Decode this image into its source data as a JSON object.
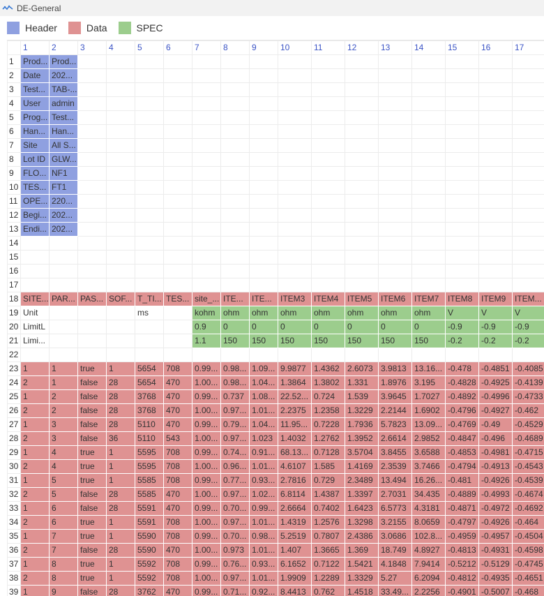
{
  "window": {
    "title": "DE-General"
  },
  "colors": {
    "header": "#8fa0e0",
    "data": "#df9292",
    "spec": "#9ccd8d",
    "column_number": "#3b54c6"
  },
  "legend": [
    {
      "label": "Header",
      "color": "#8fa0e0",
      "icon": "legend-swatch-header"
    },
    {
      "label": "Data",
      "color": "#df9292",
      "icon": "legend-swatch-data"
    },
    {
      "label": "SPEC",
      "color": "#9ccd8d",
      "icon": "legend-swatch-spec"
    }
  ],
  "grid": {
    "column_headers": [
      "1",
      "2",
      "3",
      "4",
      "5",
      "6",
      "7",
      "8",
      "9",
      "10",
      "11",
      "12",
      "13",
      "14",
      "15",
      "16",
      "17"
    ],
    "rows": [
      {
        "num": "1",
        "type": "header",
        "cells": [
          "Prod...",
          "Prod..."
        ]
      },
      {
        "num": "2",
        "type": "header",
        "cells": [
          "Date",
          "202..."
        ]
      },
      {
        "num": "3",
        "type": "header",
        "cells": [
          "Test...",
          "TAB-..."
        ]
      },
      {
        "num": "4",
        "type": "header",
        "cells": [
          "User",
          "admin"
        ]
      },
      {
        "num": "5",
        "type": "header",
        "cells": [
          "Prog...",
          "Test..."
        ]
      },
      {
        "num": "6",
        "type": "header",
        "cells": [
          "Han...",
          "Han..."
        ]
      },
      {
        "num": "7",
        "type": "header",
        "cells": [
          "Site",
          "All S..."
        ]
      },
      {
        "num": "8",
        "type": "header",
        "cells": [
          "Lot ID",
          "GLW..."
        ]
      },
      {
        "num": "9",
        "type": "header",
        "cells": [
          "FLO...",
          "NF1"
        ]
      },
      {
        "num": "10",
        "type": "header",
        "cells": [
          "TES...",
          "FT1"
        ]
      },
      {
        "num": "11",
        "type": "header",
        "cells": [
          "OPE...",
          "220..."
        ]
      },
      {
        "num": "12",
        "type": "header",
        "cells": [
          "Begi...",
          "202..."
        ]
      },
      {
        "num": "13",
        "type": "header",
        "cells": [
          "Endi...",
          "202..."
        ]
      },
      {
        "num": "14",
        "type": "empty",
        "cells": []
      },
      {
        "num": "15",
        "type": "empty",
        "cells": []
      },
      {
        "num": "16",
        "type": "empty",
        "cells": []
      },
      {
        "num": "17",
        "type": "empty",
        "cells": []
      },
      {
        "num": "18",
        "type": "data",
        "cells": [
          "SITE...",
          "PAR...",
          "PAS...",
          "SOF...",
          "T_TI...",
          "TES...",
          "site_...",
          "ITE...",
          "ITE...",
          "ITEM3",
          "ITEM4",
          "ITEM5",
          "ITEM6",
          "ITEM7",
          "ITEM8",
          "ITEM9",
          "ITEM..."
        ]
      },
      {
        "num": "19",
        "type": "spec",
        "cells": [
          "Unit",
          "",
          "",
          "",
          "ms",
          "",
          "kohm",
          "ohm",
          "ohm",
          "ohm",
          "ohm",
          "ohm",
          "ohm",
          "ohm",
          "V",
          "V",
          "V"
        ]
      },
      {
        "num": "20",
        "type": "spec",
        "cells": [
          "LimitL",
          "",
          "",
          "",
          "",
          "",
          "0.9",
          "0",
          "0",
          "0",
          "0",
          "0",
          "0",
          "0",
          "-0.9",
          "-0.9",
          "-0.9"
        ]
      },
      {
        "num": "21",
        "type": "spec",
        "cells": [
          "Limi...",
          "",
          "",
          "",
          "",
          "",
          "1.1",
          "150",
          "150",
          "150",
          "150",
          "150",
          "150",
          "150",
          "-0.2",
          "-0.2",
          "-0.2"
        ]
      },
      {
        "num": "22",
        "type": "empty",
        "cells": []
      },
      {
        "num": "23",
        "type": "data",
        "cells": [
          "1",
          "1",
          "true",
          "1",
          "5654",
          "708",
          "0.99...",
          "0.98...",
          "1.09...",
          "9.9877",
          "1.4362",
          "2.6073",
          "3.9813",
          "13.16...",
          "-0.478",
          "-0.4851",
          "-0.4085"
        ]
      },
      {
        "num": "24",
        "type": "data",
        "cells": [
          "2",
          "1",
          "false",
          "28",
          "5654",
          "470",
          "1.00...",
          "0.98...",
          "1.04...",
          "1.3864",
          "1.3802",
          "1.331",
          "1.8976",
          "3.195",
          "-0.4828",
          "-0.4925",
          "-0.4139"
        ]
      },
      {
        "num": "25",
        "type": "data",
        "cells": [
          "1",
          "2",
          "false",
          "28",
          "3768",
          "470",
          "0.99...",
          "0.737",
          "1.08...",
          "22.52...",
          "0.724",
          "1.539",
          "3.9645",
          "1.7027",
          "-0.4892",
          "-0.4996",
          "-0.4733"
        ]
      },
      {
        "num": "26",
        "type": "data",
        "cells": [
          "2",
          "2",
          "false",
          "28",
          "3768",
          "470",
          "1.00...",
          "0.97...",
          "1.01...",
          "2.2375",
          "1.2358",
          "1.3229",
          "2.2144",
          "1.6902",
          "-0.4796",
          "-0.4927",
          "-0.462"
        ]
      },
      {
        "num": "27",
        "type": "data",
        "cells": [
          "1",
          "3",
          "false",
          "28",
          "5110",
          "470",
          "0.99...",
          "0.79...",
          "1.04...",
          "11.95...",
          "0.7228",
          "1.7936",
          "5.7823",
          "13.09...",
          "-0.4769",
          "-0.49",
          "-0.4529"
        ]
      },
      {
        "num": "28",
        "type": "data",
        "cells": [
          "2",
          "3",
          "false",
          "36",
          "5110",
          "543",
          "1.00...",
          "0.97...",
          "1.023",
          "1.4032",
          "1.2762",
          "1.3952",
          "2.6614",
          "2.9852",
          "-0.4847",
          "-0.496",
          "-0.4689"
        ]
      },
      {
        "num": "29",
        "type": "data",
        "cells": [
          "1",
          "4",
          "true",
          "1",
          "5595",
          "708",
          "0.99...",
          "0.74...",
          "0.91...",
          "68.13...",
          "0.7128",
          "3.5704",
          "3.8455",
          "3.6588",
          "-0.4853",
          "-0.4981",
          "-0.4715"
        ]
      },
      {
        "num": "30",
        "type": "data",
        "cells": [
          "2",
          "4",
          "true",
          "1",
          "5595",
          "708",
          "1.00...",
          "0.96...",
          "1.01...",
          "4.6107",
          "1.585",
          "1.4169",
          "2.3539",
          "3.7466",
          "-0.4794",
          "-0.4913",
          "-0.4543"
        ]
      },
      {
        "num": "31",
        "type": "data",
        "cells": [
          "1",
          "5",
          "true",
          "1",
          "5585",
          "708",
          "0.99...",
          "0.77...",
          "0.93...",
          "2.7816",
          "0.729",
          "2.3489",
          "13.494",
          "16.26...",
          "-0.481",
          "-0.4926",
          "-0.4539"
        ]
      },
      {
        "num": "32",
        "type": "data",
        "cells": [
          "2",
          "5",
          "false",
          "28",
          "5585",
          "470",
          "1.00...",
          "0.97...",
          "1.02...",
          "6.8114",
          "1.4387",
          "1.3397",
          "2.7031",
          "34.435",
          "-0.4889",
          "-0.4993",
          "-0.4674"
        ]
      },
      {
        "num": "33",
        "type": "data",
        "cells": [
          "1",
          "6",
          "false",
          "28",
          "5591",
          "470",
          "0.99...",
          "0.70...",
          "0.99...",
          "2.6664",
          "0.7402",
          "1.6423",
          "6.5773",
          "4.3181",
          "-0.4871",
          "-0.4972",
          "-0.4692"
        ]
      },
      {
        "num": "34",
        "type": "data",
        "cells": [
          "2",
          "6",
          "true",
          "1",
          "5591",
          "708",
          "1.00...",
          "0.97...",
          "1.01...",
          "1.4319",
          "1.2576",
          "1.3298",
          "3.2155",
          "8.0659",
          "-0.4797",
          "-0.4926",
          "-0.464"
        ]
      },
      {
        "num": "35",
        "type": "data",
        "cells": [
          "1",
          "7",
          "true",
          "1",
          "5590",
          "708",
          "0.99...",
          "0.70...",
          "0.98...",
          "5.2519",
          "0.7807",
          "2.4386",
          "3.0686",
          "102.8...",
          "-0.4959",
          "-0.4957",
          "-0.4504"
        ]
      },
      {
        "num": "36",
        "type": "data",
        "cells": [
          "2",
          "7",
          "false",
          "28",
          "5590",
          "470",
          "1.00...",
          "0.973",
          "1.01...",
          "1.407",
          "1.3665",
          "1.369",
          "18.749",
          "4.8927",
          "-0.4813",
          "-0.4931",
          "-0.4598"
        ]
      },
      {
        "num": "37",
        "type": "data",
        "cells": [
          "1",
          "8",
          "true",
          "1",
          "5592",
          "708",
          "0.99...",
          "0.76...",
          "0.93...",
          "6.1652",
          "0.7122",
          "1.5421",
          "4.1848",
          "7.9414",
          "-0.5212",
          "-0.5129",
          "-0.4745"
        ]
      },
      {
        "num": "38",
        "type": "data",
        "cells": [
          "2",
          "8",
          "true",
          "1",
          "5592",
          "708",
          "1.00...",
          "0.97...",
          "1.01...",
          "1.9909",
          "1.2289",
          "1.3329",
          "5.27",
          "6.2094",
          "-0.4812",
          "-0.4935",
          "-0.4651"
        ]
      },
      {
        "num": "39",
        "type": "data",
        "cells": [
          "1",
          "9",
          "false",
          "28",
          "3762",
          "470",
          "0.99...",
          "0.71...",
          "0.92...",
          "8.4413",
          "0.762",
          "1.4518",
          "33.49...",
          "2.2256",
          "-0.4901",
          "-0.5007",
          "-0.468"
        ]
      }
    ]
  }
}
